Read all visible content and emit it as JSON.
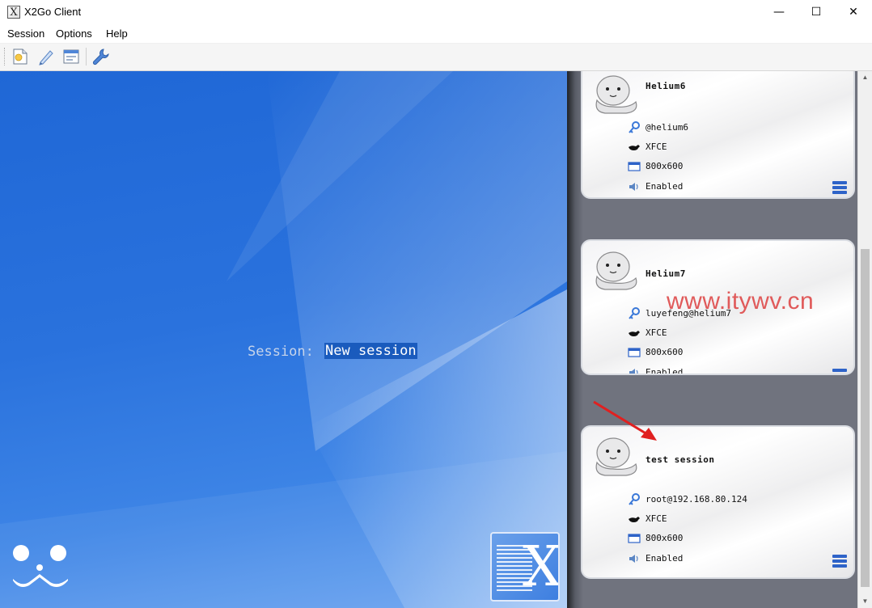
{
  "window": {
    "title": "X2Go Client",
    "minimize": "—",
    "maximize": "☐",
    "close": "✕"
  },
  "menu": [
    "Session",
    "Options",
    "Help"
  ],
  "toolbar": [
    "new-session-icon",
    "edit-session-icon",
    "session-export-icon",
    "settings-wrench-icon"
  ],
  "main": {
    "session_label": "Session:",
    "session_value": "New session"
  },
  "sessions": [
    {
      "name": "Helium6",
      "user_host": "@helium6",
      "desktop": "XFCE",
      "geometry": "800x600",
      "sound": "Enabled"
    },
    {
      "name": "Helium7",
      "user_host": "luyefeng@helium7",
      "desktop": "XFCE",
      "geometry": "800x600",
      "sound": "Enabled"
    },
    {
      "name": "test session",
      "user_host": "root@192.168.80.124",
      "desktop": "XFCE",
      "geometry": "800x600",
      "sound": "Enabled"
    }
  ],
  "watermark": "www.itywv.cn",
  "colors": {
    "panel_blue": "#2a72dd",
    "card_bg": "#ffffff",
    "list_bg": "#70737e",
    "accent_icon": "#2e63c8",
    "annotation_red": "#e02020"
  }
}
